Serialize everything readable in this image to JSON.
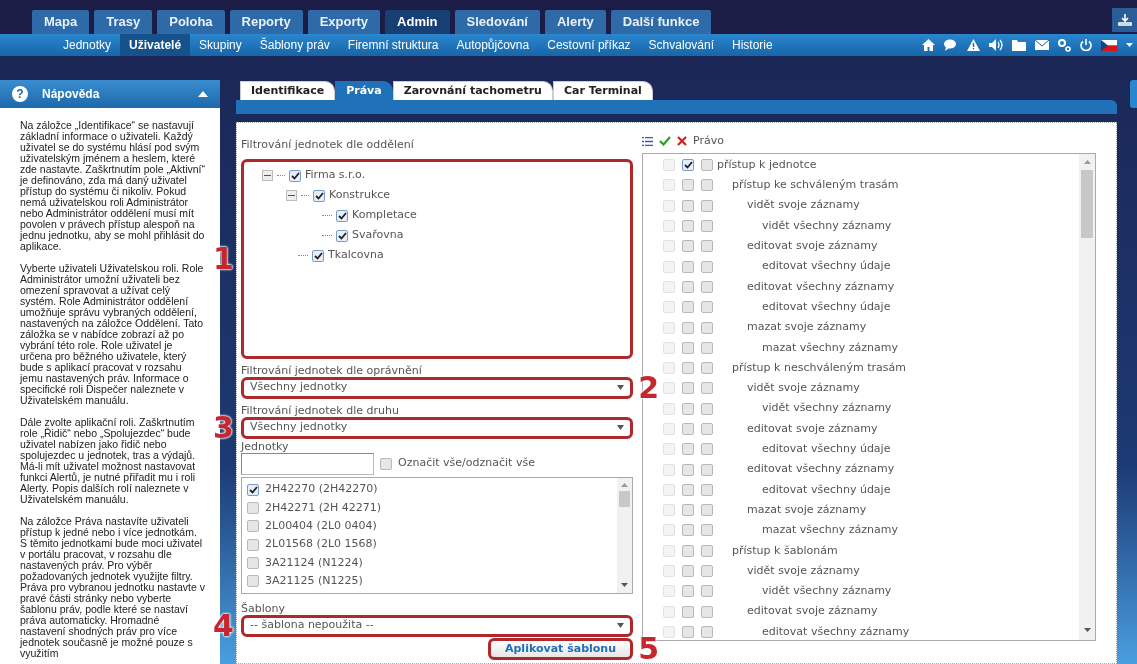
{
  "top_tabs": [
    {
      "label": "Mapa",
      "selected": false
    },
    {
      "label": "Trasy",
      "selected": false
    },
    {
      "label": "Poloha",
      "selected": false
    },
    {
      "label": "Reporty",
      "selected": false
    },
    {
      "label": "Exporty",
      "selected": false
    },
    {
      "label": "Admin",
      "selected": true
    },
    {
      "label": "Sledování",
      "selected": false
    },
    {
      "label": "Alerty",
      "selected": false
    },
    {
      "label": "Další funkce",
      "selected": false
    }
  ],
  "sub_nav": [
    {
      "label": "Jednotky",
      "selected": false
    },
    {
      "label": "Uživatelé",
      "selected": true
    },
    {
      "label": "Skupiny",
      "selected": false
    },
    {
      "label": "Šablony práv",
      "selected": false
    },
    {
      "label": "Firemní struktura",
      "selected": false
    },
    {
      "label": "Autopůjčovna",
      "selected": false
    },
    {
      "label": "Cestovní příkaz",
      "selected": false
    },
    {
      "label": "Schvalování",
      "selected": false
    },
    {
      "label": "Historie",
      "selected": false
    }
  ],
  "help": {
    "icon": "?",
    "title": "Nápověda",
    "paragraphs": [
      "Na záložce „Identifikace“ se nastavují základní informace o uživateli. Každý uživatel se do systému hlásí pod svým uživatelským jménem a heslem, které zde nastavte. Zaškrtnutím pole „Aktivní“ je definováno, zda má daný uživatel přístup do systému či nikoliv. Pokud nemá uživatelskou roli Administrátor nebo Administrátor oddělení musí mít povolen v právech přístup alespoň na jednu jednotku, aby se mohl přihlásit do aplikace.",
      "Vyberte uživateli Uživatelskou roli. Role Administrátor umožní uživateli bez omezení spravovat a užívat celý systém. Role Administrátor oddělení umožňuje správu vybraných oddělení, nastavených na záložce Oddělení. Tato záložka se v nabídce zobrazí až po vybrání této role. Role uživatel je určena pro běžného uživatele, který bude s aplikací pracovat v rozsahu jemu nastavených práv. Informace o specifické roli Dispečer naleznete v Uživatelském manuálu.",
      "Dále zvolte aplikační roli. Zaškrtnutím role „Řidič“ nebo „Spolujezdec“ bude uživatel nabízen jako řidič nebo spolujezdec u jednotek, tras a výdajů. Má-li mít uživatel možnost nastavovat funkci Alertů, je nutné přiřadit mu i roli Alerty. Popis dalších rolí naleznete v Uživatelském manuálu.",
      "Na záložce Práva nastavíte uživateli přístup k jedné nebo i více jednotkám. S těmito jednotkami bude moci uživatel v portálu pracovat, v rozsahu dle nastavených práv. Pro výběr požadovaných jednotek využijte filtry. Práva pro vybranou jednotku nastavte v pravé části stránky nebo vyberte šablonu práv, podle které se nastaví práva automaticky. Hromadné nastavení shodných práv pro více jednotek současně je možné pouze s využitím"
    ]
  },
  "page_tabs": [
    {
      "label": "Identifikace",
      "selected": false
    },
    {
      "label": "Práva",
      "selected": true
    },
    {
      "label": "Zarovnání tachometru",
      "selected": false
    },
    {
      "label": "Car Terminal",
      "selected": false
    }
  ],
  "department_filter": {
    "label": "Filtrování jednotek dle oddělení",
    "callout": "1",
    "tree": [
      {
        "label": "Firma s.r.o.",
        "checked": true,
        "expanded": true,
        "children": [
          {
            "label": "Konstrukce",
            "checked": true,
            "expanded": true,
            "children": [
              {
                "label": "Kompletace",
                "checked": true
              },
              {
                "label": "Svařovna",
                "checked": true
              }
            ]
          },
          {
            "label": "Tkalcovna",
            "checked": true
          }
        ]
      }
    ]
  },
  "permission_filter": {
    "label": "Filtrování jednotek dle oprávnění",
    "value": "Všechny jednotky",
    "callout": "2"
  },
  "type_filter": {
    "label": "Filtrování jednotek dle druhu",
    "value": "Všechny jednotky",
    "callout": "3"
  },
  "units": {
    "label": "Jednotky",
    "select_all": {
      "label": "Označit vše/odznačit vše",
      "checked": false
    },
    "items": [
      {
        "label": "2H42270 (2H42270)",
        "checked": true
      },
      {
        "label": "2H42271 (2H 42271)",
        "checked": false
      },
      {
        "label": "2L00404 (2L0 0404)",
        "checked": false
      },
      {
        "label": "2L01568 (2L0 1568)",
        "checked": false
      },
      {
        "label": "3A21124 (N1224)",
        "checked": false
      },
      {
        "label": "3A21125 (N1225)",
        "checked": false
      }
    ]
  },
  "templates": {
    "label": "Šablony",
    "value": "-- šablona nepoužita --",
    "callout": "4"
  },
  "apply_button": {
    "label": "Aplikovat šablonu",
    "callout": "5"
  },
  "rights": {
    "header": "Právo",
    "items": [
      {
        "label": "přístup k jednotce",
        "inherit": false,
        "allow": true,
        "deny": false,
        "children": [
          {
            "label": "přístup ke schváleným trasám",
            "inherit": false,
            "allow": false,
            "deny": false,
            "children": [
              {
                "label": "vidět svoje záznamy",
                "inherit": false,
                "allow": false,
                "deny": false,
                "children": [
                  {
                    "label": "vidět všechny záznamy",
                    "inherit": false,
                    "allow": false,
                    "deny": false
                  }
                ]
              },
              {
                "label": "editovat svoje záznamy",
                "inherit": false,
                "allow": false,
                "deny": false,
                "children": [
                  {
                    "label": "editovat všechny údaje",
                    "inherit": false,
                    "allow": false,
                    "deny": false
                  }
                ]
              },
              {
                "label": "editovat všechny záznamy",
                "inherit": false,
                "allow": false,
                "deny": false,
                "children": [
                  {
                    "label": "editovat všechny údaje",
                    "inherit": false,
                    "allow": false,
                    "deny": false
                  }
                ]
              },
              {
                "label": "mazat svoje záznamy",
                "inherit": false,
                "allow": false,
                "deny": false,
                "children": [
                  {
                    "label": "mazat všechny záznamy",
                    "inherit": false,
                    "allow": false,
                    "deny": false
                  }
                ]
              }
            ]
          },
          {
            "label": "přístup k neschváleným trasám",
            "inherit": false,
            "allow": false,
            "deny": false,
            "children": [
              {
                "label": "vidět svoje záznamy",
                "inherit": false,
                "allow": false,
                "deny": false,
                "children": [
                  {
                    "label": "vidět všechny záznamy",
                    "inherit": false,
                    "allow": false,
                    "deny": false
                  }
                ]
              },
              {
                "label": "editovat svoje záznamy",
                "inherit": false,
                "allow": false,
                "deny": false,
                "children": [
                  {
                    "label": "editovat všechny údaje",
                    "inherit": false,
                    "allow": false,
                    "deny": false
                  }
                ]
              },
              {
                "label": "editovat všechny záznamy",
                "inherit": false,
                "allow": false,
                "deny": false,
                "children": [
                  {
                    "label": "editovat všechny údaje",
                    "inherit": false,
                    "allow": false,
                    "deny": false
                  }
                ]
              },
              {
                "label": "mazat svoje záznamy",
                "inherit": false,
                "allow": false,
                "deny": false,
                "children": [
                  {
                    "label": "mazat všechny záznamy",
                    "inherit": false,
                    "allow": false,
                    "deny": false
                  }
                ]
              }
            ]
          },
          {
            "label": "přístup k šablonám",
            "inherit": false,
            "allow": false,
            "deny": false,
            "children": [
              {
                "label": "vidět svoje záznamy",
                "inherit": false,
                "allow": false,
                "deny": false,
                "children": [
                  {
                    "label": "vidět všechny záznamy",
                    "inherit": false,
                    "allow": false,
                    "deny": false
                  }
                ]
              },
              {
                "label": "editovat svoje záznamy",
                "inherit": false,
                "allow": false,
                "deny": false,
                "children": [
                  {
                    "label": "editovat všechny záznamy",
                    "inherit": false,
                    "allow": false,
                    "deny": false
                  }
                ]
              }
            ]
          }
        ]
      }
    ]
  }
}
